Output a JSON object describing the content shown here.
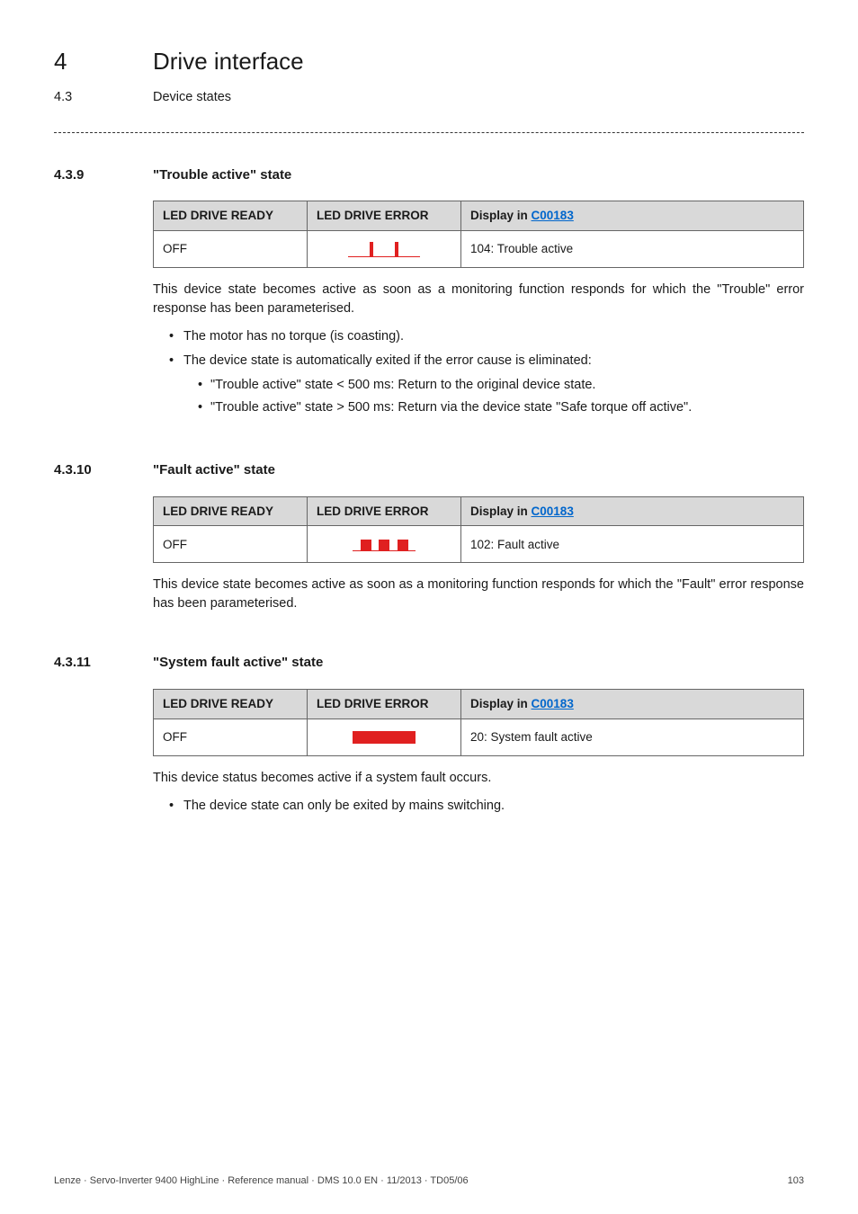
{
  "chapter": {
    "num": "4",
    "title": "Drive interface"
  },
  "subchapter": {
    "num": "4.3",
    "title": "Device states"
  },
  "link_code": "C00183",
  "table_headers": {
    "ready": "LED DRIVE READY",
    "error": "LED DRIVE ERROR",
    "display_prefix": "Display in "
  },
  "sections": [
    {
      "num": "4.3.9",
      "title": "\"Trouble active\" state",
      "led_ready": "OFF",
      "led_error_icon": "trouble",
      "display_text": "104: Trouble active",
      "paragraph": "This device state becomes active as soon as a monitoring function responds for which the \"Trouble\" error response has been parameterised.",
      "bullets": [
        {
          "text": "The motor has no torque (is coasting)."
        },
        {
          "text": "The device state is automatically exited if the error cause is eliminated:",
          "sub": [
            "\"Trouble active\" state < 500 ms: Return to the original device state.",
            "\"Trouble active\" state > 500 ms: Return via the device state \"Safe torque off active\"."
          ]
        }
      ]
    },
    {
      "num": "4.3.10",
      "title": "\"Fault active\" state",
      "led_ready": "OFF",
      "led_error_icon": "fault",
      "display_text": "102: Fault active",
      "paragraph": "This device state becomes active as soon as a monitoring function responds for which the \"Fault\" error response has been parameterised."
    },
    {
      "num": "4.3.11",
      "title": "\"System fault active\" state",
      "led_ready": "OFF",
      "led_error_icon": "solid",
      "display_text": "20: System fault active",
      "paragraph": "This device status becomes active if a system fault occurs.",
      "bullets": [
        {
          "text": "The device state can only be exited by mains switching."
        }
      ]
    }
  ],
  "footer": {
    "left": "Lenze · Servo-Inverter 9400 HighLine · Reference manual · DMS 10.0 EN · 11/2013 · TD05/06",
    "right": "103"
  }
}
